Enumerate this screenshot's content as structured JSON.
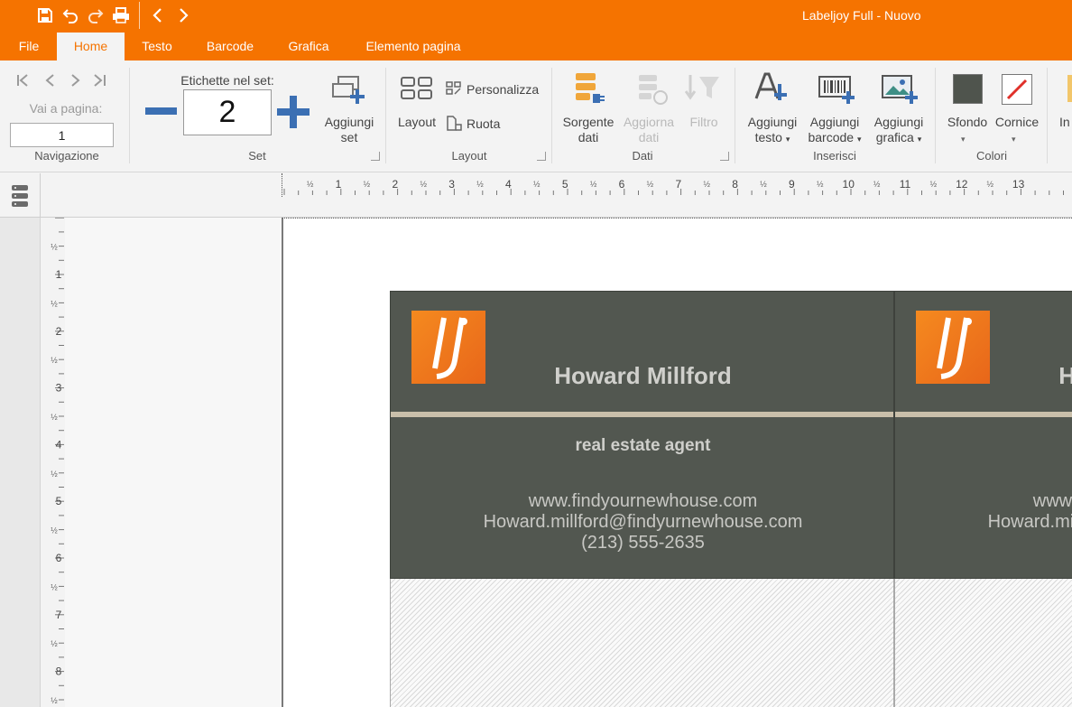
{
  "titlebar": {
    "title": "Labeljoy Full - Nuovo"
  },
  "menu": {
    "tabs": [
      {
        "label": "File",
        "active": false
      },
      {
        "label": "Home",
        "active": true
      },
      {
        "label": "Testo",
        "active": false
      },
      {
        "label": "Barcode",
        "active": false
      },
      {
        "label": "Grafica",
        "active": false
      },
      {
        "label": "Elemento pagina",
        "active": false
      }
    ]
  },
  "ribbon": {
    "navigazione": {
      "goto_label": "Vai a pagina:",
      "goto_value": "1",
      "group": "Navigazione"
    },
    "set": {
      "count_label": "Etichette nel set:",
      "count_value": "2",
      "add_line1": "Aggiungi",
      "add_line2": "set",
      "group": "Set"
    },
    "layout": {
      "layout_btn": "Layout",
      "personalizza": "Personalizza",
      "ruota": "Ruota",
      "group": "Layout"
    },
    "dati": {
      "sorgente_line1": "Sorgente",
      "sorgente_line2": "dati",
      "aggiorna_line1": "Aggiorna",
      "aggiorna_line2": "dati",
      "filtro": "Filtro",
      "group": "Dati"
    },
    "inserisci": {
      "testo_line1": "Aggiungi",
      "testo_line2": "testo",
      "barcode_line1": "Aggiungi",
      "barcode_line2": "barcode",
      "grafica_line1": "Aggiungi",
      "grafica_line2": "grafica",
      "group": "Inserisci"
    },
    "colori": {
      "sfondo": "Sfondo",
      "cornice": "Cornice",
      "group": "Colori",
      "sfondo_color": "#4f544d",
      "cornice_color": "#e0302a"
    },
    "overflow": "In"
  },
  "ruler": {
    "numbers": [
      "1",
      "2",
      "3",
      "4",
      "5",
      "6",
      "7",
      "8",
      "9",
      "10",
      "11",
      "12",
      "13"
    ],
    "half": "½",
    "vnumbers": [
      "1",
      "2",
      "3",
      "4",
      "5",
      "6",
      "7",
      "8"
    ]
  },
  "card": {
    "name": "Howard Millford",
    "role": "real estate agent",
    "website": "www.findyournewhouse.com",
    "email": "Howard.millford@findyurnewhouse.com",
    "phone": "(213) 555-2635",
    "bg_color": "#525750",
    "accent_color": "#f57300"
  }
}
